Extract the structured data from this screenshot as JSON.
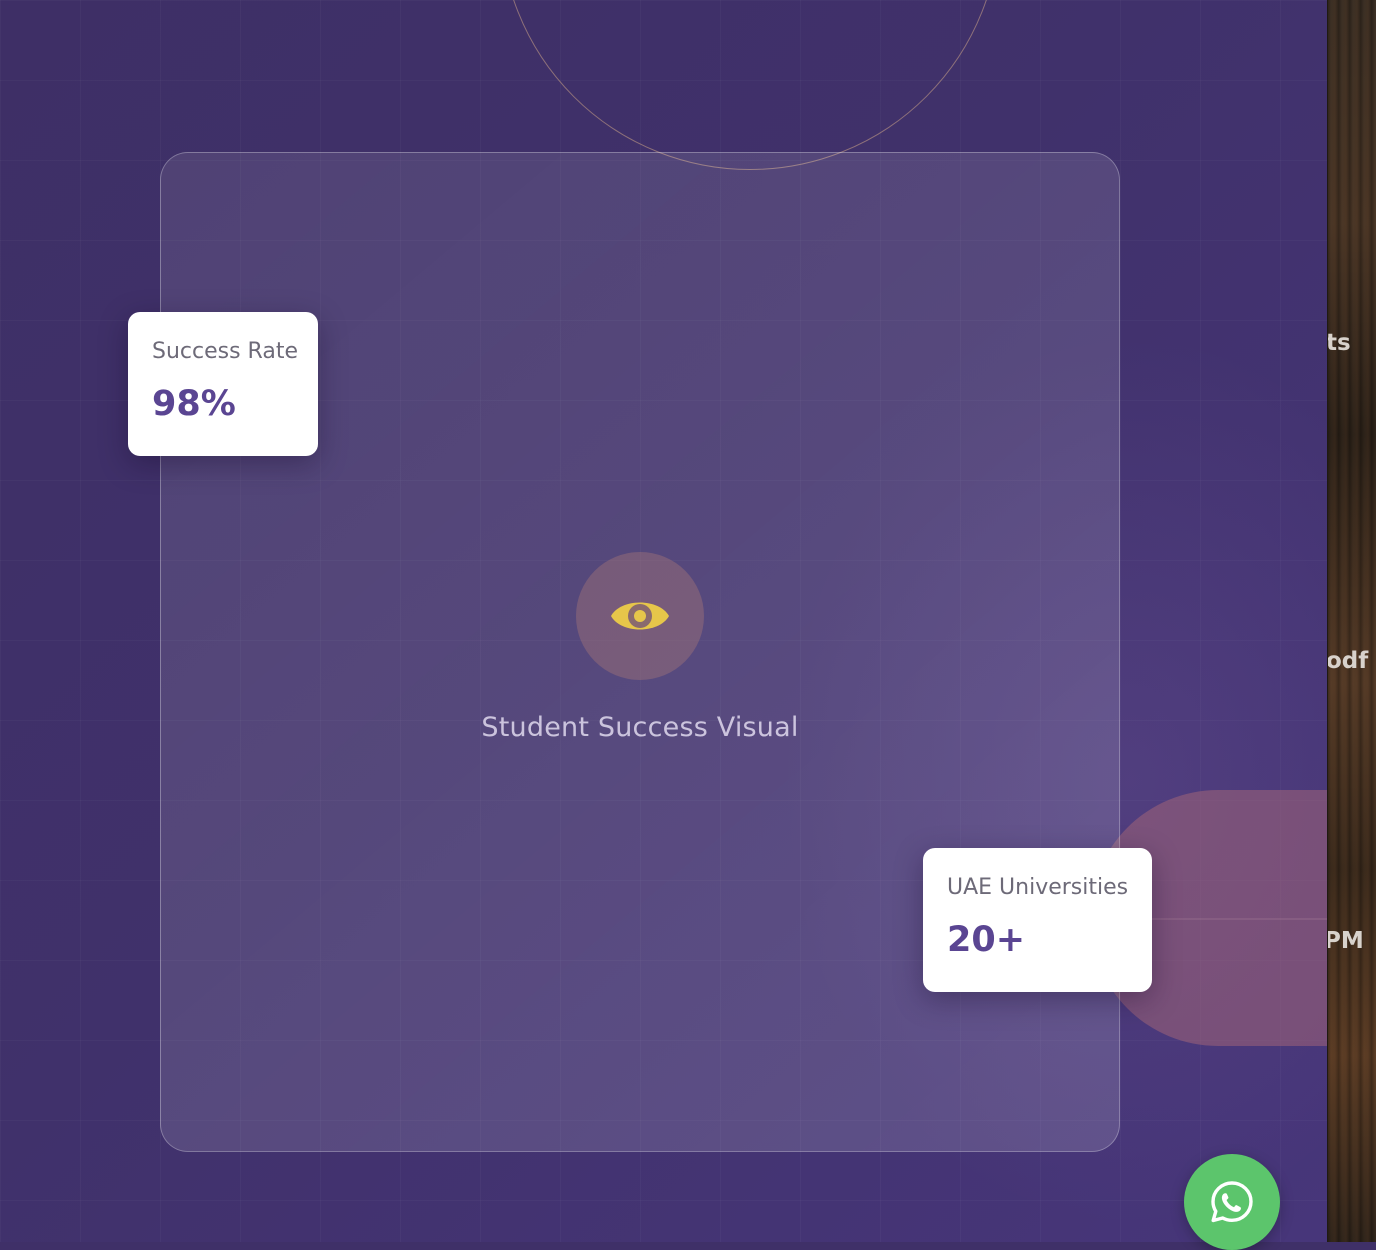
{
  "stats": {
    "success_rate": {
      "label": "Success Rate",
      "value": "98%"
    },
    "uae_universities": {
      "label": "UAE Universities",
      "value": "20+"
    }
  },
  "visual": {
    "icon": "eye-icon",
    "caption": "Student Success Visual"
  },
  "side_panel": {
    "fragments": [
      "ts",
      "odf",
      "PM"
    ]
  },
  "whatsapp": {
    "icon": "whatsapp-icon"
  },
  "colors": {
    "background": "#40316b",
    "accent_purple": "#5a4592",
    "eye_yellow": "#e6c64a",
    "whatsapp_green": "#5cc56c",
    "card_white": "#ffffff"
  }
}
